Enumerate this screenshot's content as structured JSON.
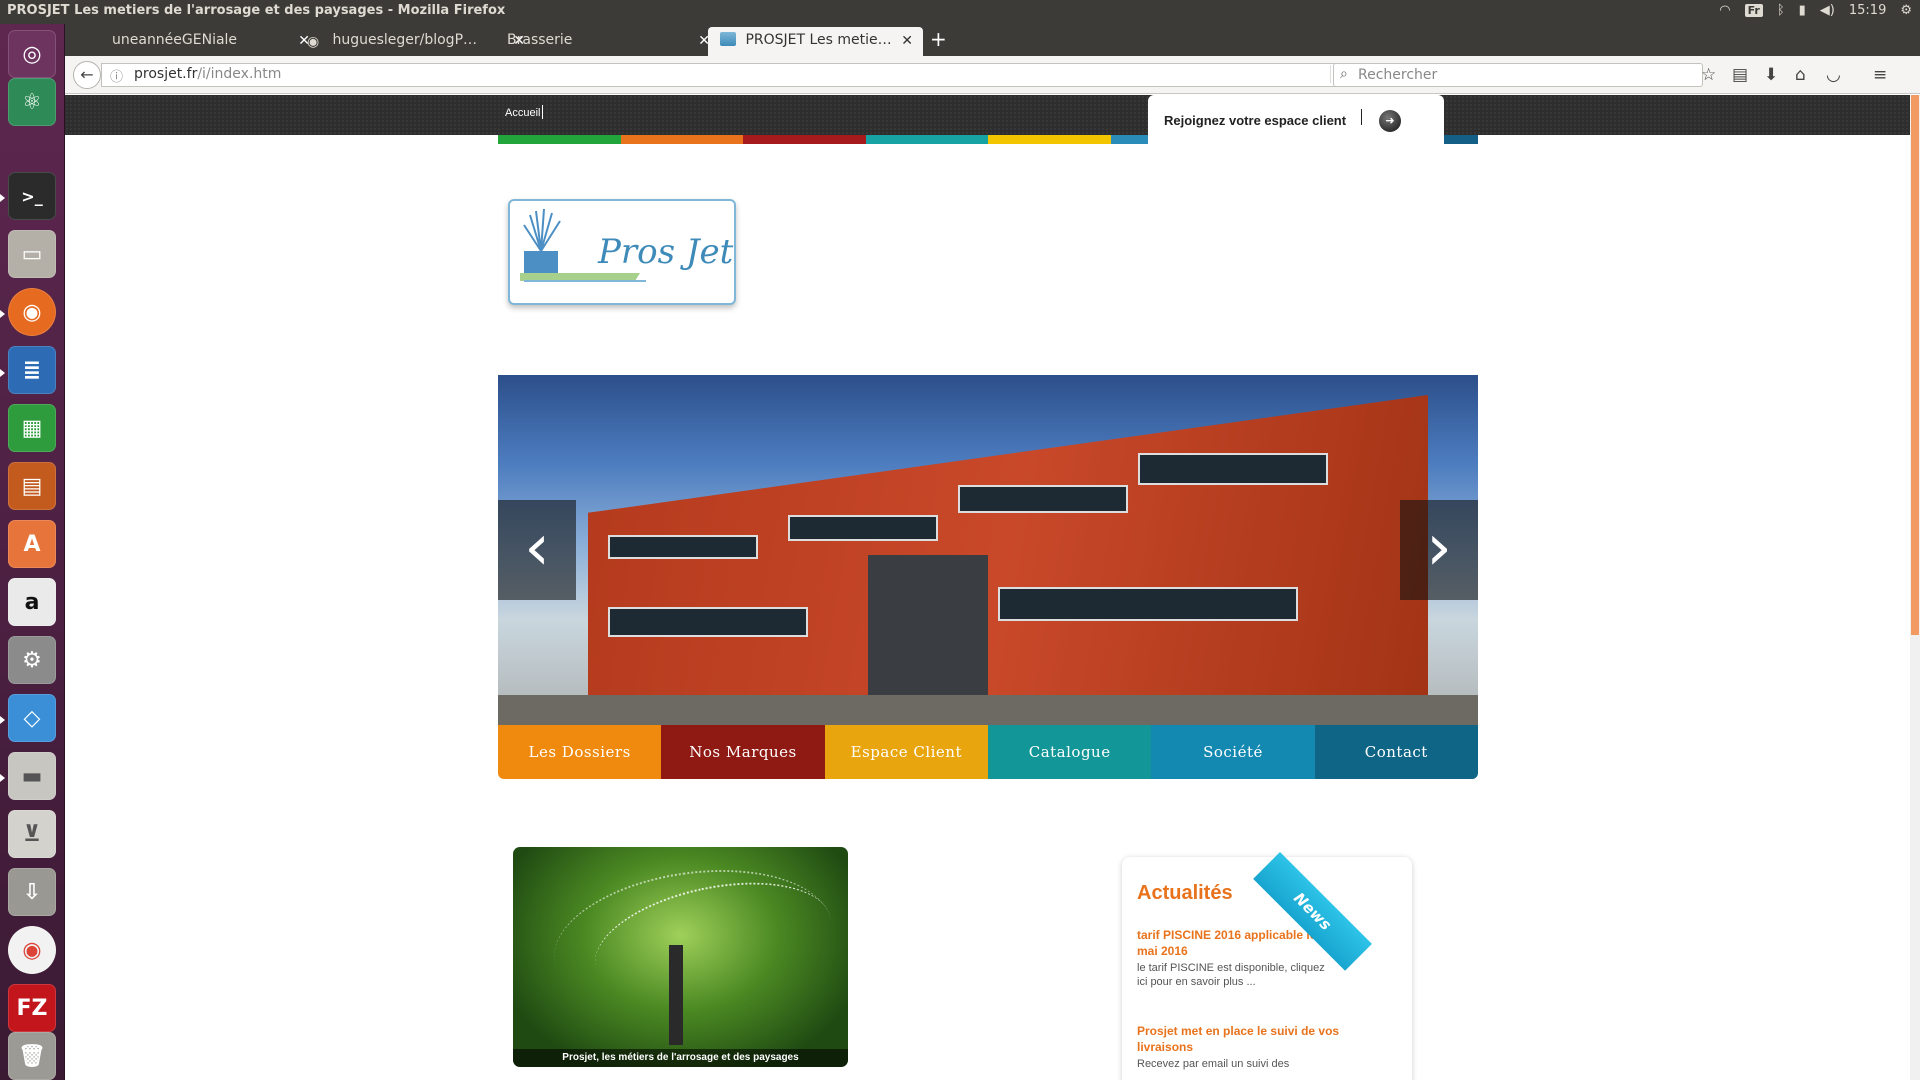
{
  "window": {
    "title": "PROSJET Les metiers de l'arrosage et des paysages - Mozilla Firefox",
    "clock": "15:19",
    "keyboard": "Fr"
  },
  "launcher": {
    "items": [
      "ubuntu-dash",
      "atom",
      "terminal",
      "file-manager",
      "firefox",
      "writer",
      "calc",
      "impress",
      "software-center",
      "amazon",
      "system-settings",
      "virtualbox",
      "disks",
      "scanner",
      "usb-creator",
      "chrome",
      "filezilla",
      "trash"
    ]
  },
  "tabs": [
    {
      "label": "uneannéeGENiale"
    },
    {
      "label": "huguesleger/blogP…"
    },
    {
      "label": "Brasserie"
    },
    {
      "label": "PROSJET Les metie…"
    }
  ],
  "nav": {
    "url_host": "prosjet.fr",
    "url_path": "/i/index.htm",
    "search_placeholder": "Rechercher"
  },
  "site": {
    "top_link": "Accueil",
    "client_cta": "Rejoignez votre espace client",
    "color_strip": [
      "#22a53a",
      "#e8731c",
      "#a6191c",
      "#17a3a3",
      "#f2c500",
      "#2a8cb8",
      "#1b6fa0",
      "#145f86"
    ],
    "menu": [
      {
        "label": "Les Dossiers",
        "color": "#f08a0e"
      },
      {
        "label": "Nos Marques",
        "color": "#8f1a14"
      },
      {
        "label": "Espace Client",
        "color": "#e9a50d"
      },
      {
        "label": "Catalogue",
        "color": "#139698"
      },
      {
        "label": "Société",
        "color": "#1388b1"
      },
      {
        "label": "Contact",
        "color": "#0f6585"
      }
    ],
    "photo_caption": "Prosjet, les métiers de l'arrosage et des paysages",
    "news": {
      "heading": "Actualités",
      "ribbon": "News",
      "items": [
        {
          "title": "tarif PISCINE 2016 applicable le 1er mai 2016",
          "body": "le tarif PISCINE est disponible, cliquez ici pour en savoir plus ..."
        },
        {
          "title": "Prosjet met en place le suivi de vos livraisons",
          "body": "Recevez par email un suivi des"
        }
      ]
    }
  }
}
